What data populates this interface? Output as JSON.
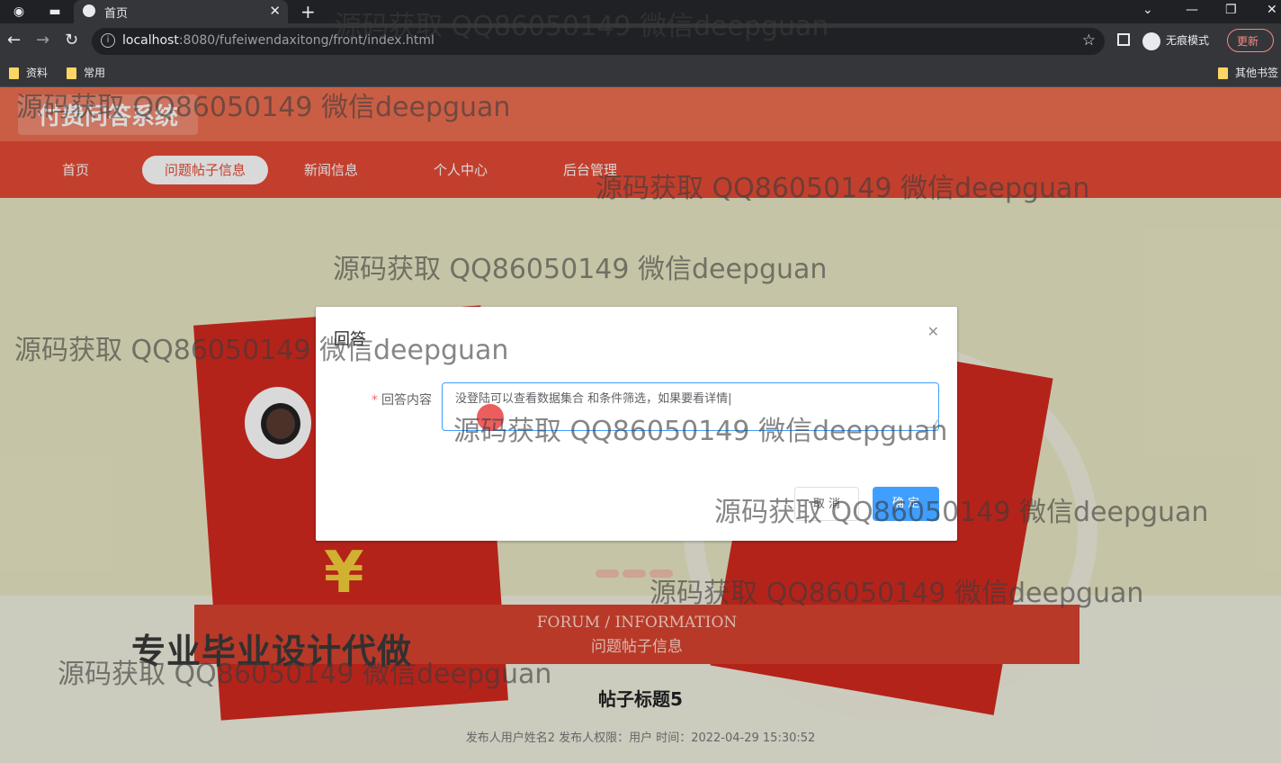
{
  "browser": {
    "tab_title": "首页",
    "url_host": "localhost",
    "url_rest": ":8080/fufeiwendaxitong/front/index.html",
    "incognito_label": "无痕模式",
    "update_label": "更新",
    "bookmarks": [
      "资料",
      "常用"
    ],
    "other_bookmarks": "其他书签"
  },
  "site": {
    "title": "付费问答系统",
    "nav": [
      "首页",
      "问题帖子信息",
      "新闻信息",
      "个人中心",
      "后台管理"
    ],
    "active_nav_index": 1
  },
  "section": {
    "en": "FORUM / INFORMATION",
    "cn": "问题帖子信息"
  },
  "post": {
    "title": "帖子标题5",
    "meta": "发布人用户姓名2   发布人权限：用户   时间：2022-04-29 15:30:52"
  },
  "promo": "专业毕业设计代做",
  "dialog": {
    "title": "回答",
    "field_label": "回答内容",
    "field_value": "没登陆可以查看数据集合 和条件筛选，如果要看详情|",
    "cancel_label": "取 消",
    "ok_label": "确 定"
  },
  "watermark": "源码获取 QQ86050149 微信deepguan"
}
